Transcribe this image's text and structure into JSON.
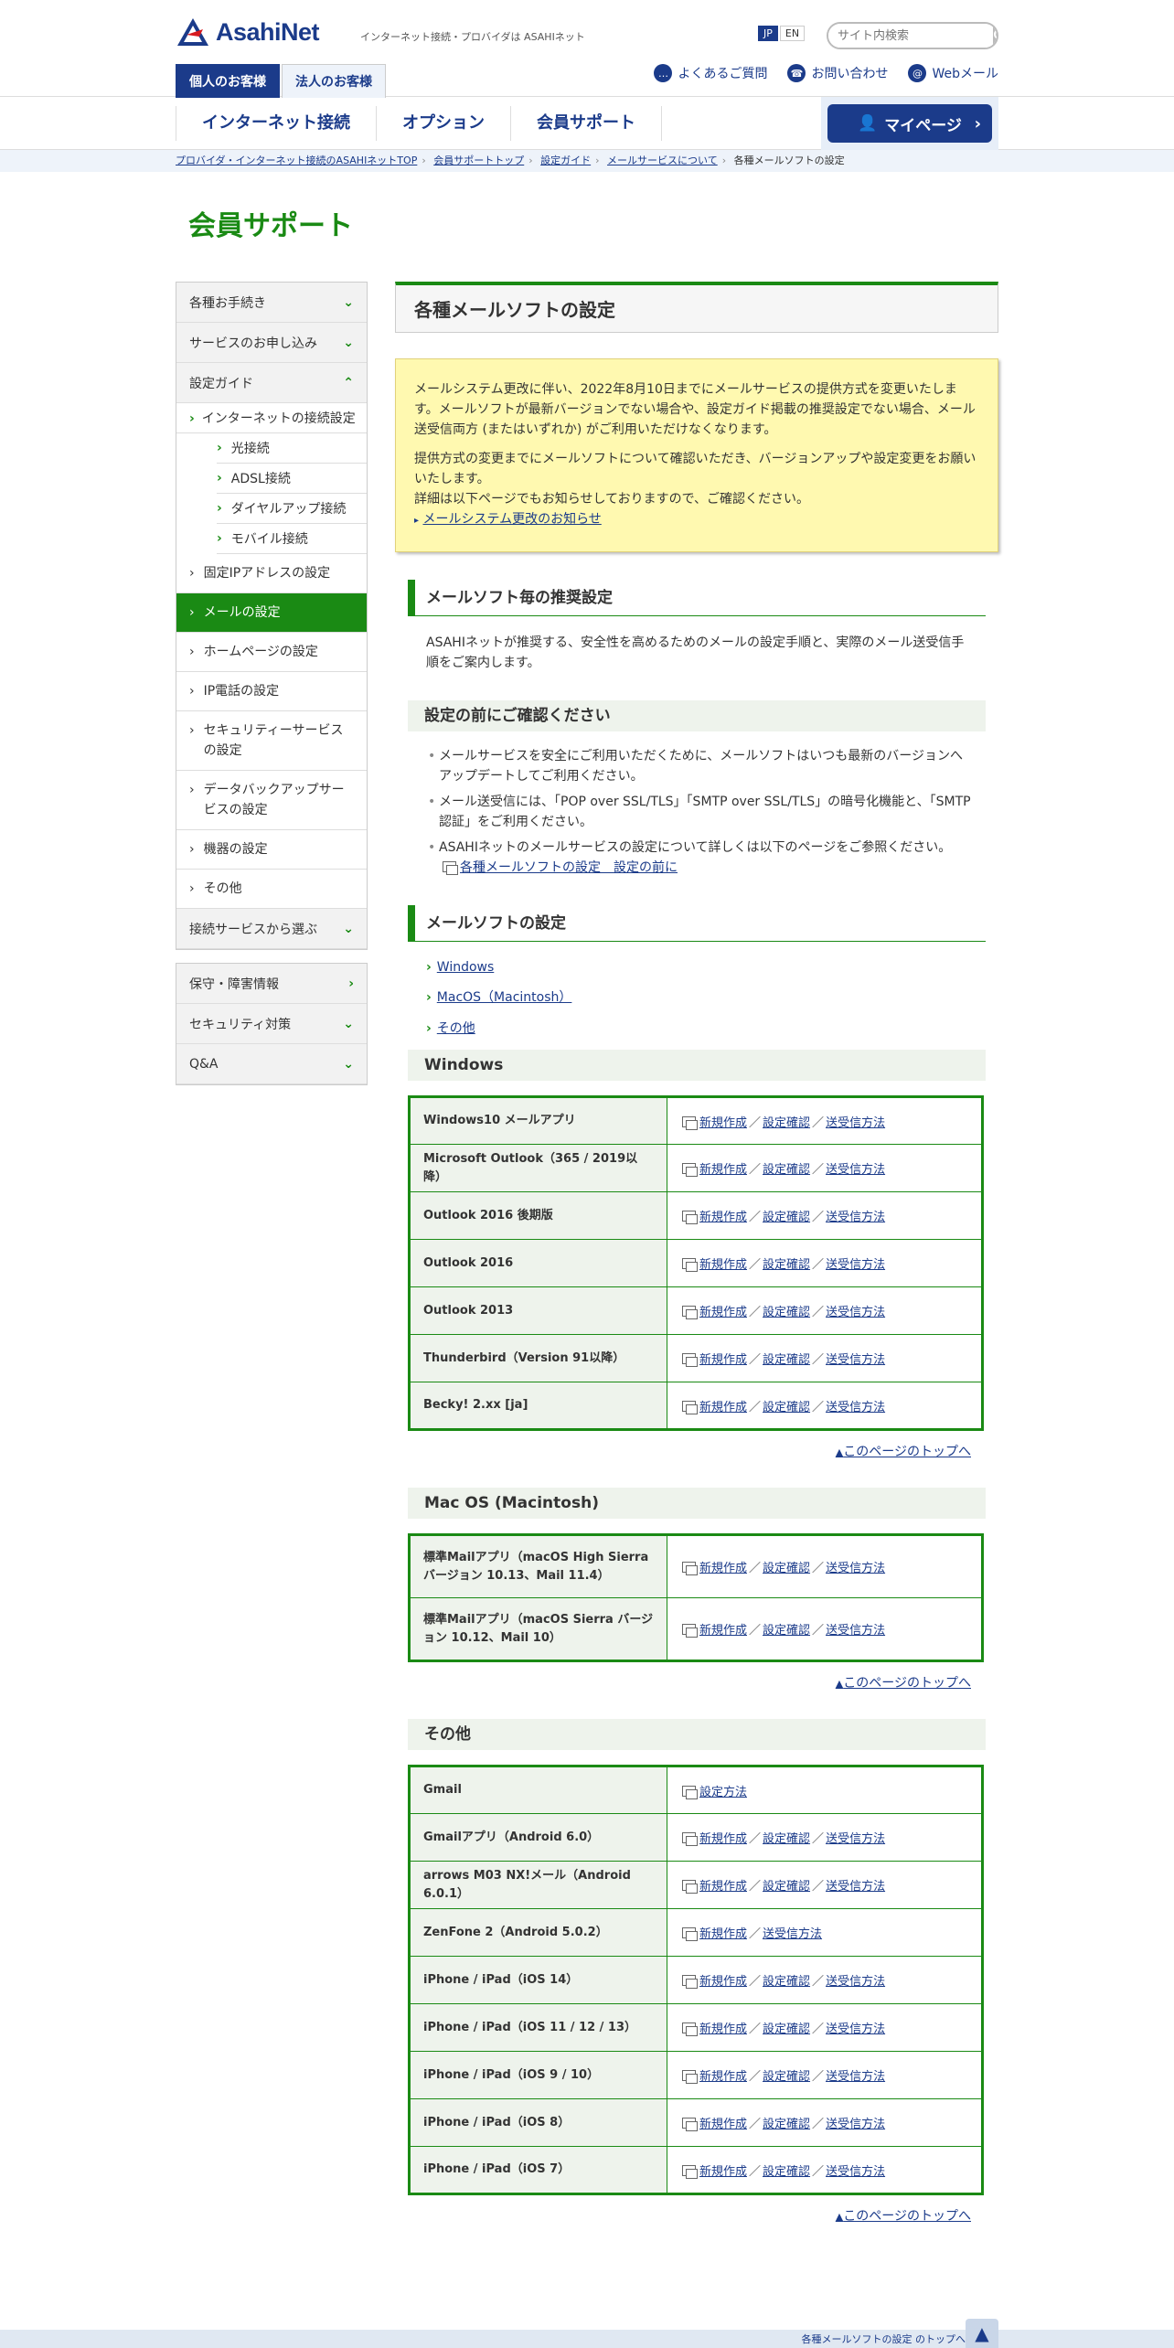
{
  "header": {
    "logo_text": "AsahiNet",
    "tagline": "インターネット接続・プロバイダは ASAHIネット",
    "lang": [
      "JP",
      "EN"
    ],
    "search_placeholder": "サイト内検索",
    "tabs": [
      "個人のお客様",
      "法人のお客様"
    ],
    "links": [
      "よくあるご質問",
      "お問い合わせ",
      "Webメール"
    ]
  },
  "gnav": {
    "items": [
      "インターネット接続",
      "オプション",
      "会員サポート"
    ],
    "mypage": "マイページ"
  },
  "breadcrumb": [
    "プロバイダ・インターネット接続のASAHIネットTOP",
    "会員サポートトップ",
    "設定ガイド",
    "メールサービスについて",
    "各種メールソフトの設定"
  ],
  "page_title": "会員サポート",
  "sidebar": {
    "top": [
      "各種お手続き",
      "サービスのお申し込み",
      "設定ガイド"
    ],
    "guide": "インターネットの接続設定",
    "guide_sub": [
      "光接続",
      "ADSL接続",
      "ダイヤルアップ接続",
      "モバイル接続"
    ],
    "items": [
      "固定IPアドレスの設定",
      "メールの設定",
      "ホームページの設定",
      "IP電話の設定",
      "セキュリティーサービスの設定",
      "データバックアップサービスの設定",
      "機器の設定",
      "その他"
    ],
    "select": "接続サービスから選ぶ",
    "bottom": [
      "保守・障害情報",
      "セキュリティ対策",
      "Q&A"
    ]
  },
  "main": {
    "title": "各種メールソフトの設定",
    "notice_p1": "メールシステム更改に伴い、2022年8月10日までにメールサービスの提供方式を変更いたします。メールソフトが最新バージョンでない場合や、設定ガイド掲載の推奨設定でない場合、メール送受信両方 (またはいずれか) がご利用いただけなくなります。",
    "notice_p2": "提供方式の変更までにメールソフトについて確認いただき、バージョンアップや設定変更をお願いいたします。",
    "notice_p3": "詳細は以下ページでもお知らせしておりますので、ご確認ください。",
    "notice_link": "メールシステム更改のお知らせ",
    "h2_recommend": "メールソフト毎の推奨設定",
    "recommend_text": "ASAHIネットが推奨する、安全性を高めるためのメールの設定手順と、実際のメール送受信手順をご案内します。",
    "h3_before": "設定の前にご確認ください",
    "bullets": [
      "メールサービスを安全にご利用いただくために、メールソフトはいつも最新のバージョンへアップデートしてご利用ください。",
      "メール送受信には、「POP over SSL/TLS」「SMTP over SSL/TLS」の暗号化機能と、「SMTP認証」をご利用ください。",
      "ASAHIネットのメールサービスの設定について詳しくは以下のページをご参照ください。"
    ],
    "before_link": "各種メールソフトの設定　設定の前に",
    "h2_settings": "メールソフトの設定",
    "anchors": [
      "Windows",
      "MacOS（Macintosh）",
      "その他"
    ],
    "link_new": "新規作成",
    "link_check": "設定確認",
    "link_send": "送受信方法",
    "link_setup": "設定方法",
    "to_top": "このページのトップへ",
    "windows_h": "Windows",
    "windows": [
      "Windows10 メールアプリ",
      "Microsoft Outlook（365 / 2019以降）",
      "Outlook 2016 後期版",
      "Outlook 2016",
      "Outlook 2013",
      "Thunderbird（Version 91以降）",
      "Becky! 2.xx [ja]"
    ],
    "mac_h": "Mac OS (Macintosh)",
    "mac": [
      "標準Mailアプリ（macOS High Sierra バージョン 10.13、Mail 11.4）",
      "標準Mailアプリ（macOS Sierra バージョン 10.12、Mail 10）"
    ],
    "other_h": "その他",
    "other": [
      "Gmail",
      "Gmailアプリ（Android 6.0）",
      "arrows M03 NX!メール（Android 6.0.1）",
      "ZenFone 2（Android 5.0.2）",
      "iPhone / iPad（iOS 14）",
      "iPhone / iPad（iOS 11 / 12 / 13）",
      "iPhone / iPad（iOS 9 / 10）",
      "iPhone / iPad（iOS 8）",
      "iPhone / iPad（iOS 7）"
    ]
  },
  "footer": {
    "crumb": "各種メールソフトの設定 のトップへ"
  },
  "colors": {
    "brand_blue": "#1b3b8a",
    "accent_green": "#1a8a14",
    "notice_yellow": "#fff9b0"
  },
  "icons": [
    "logo-mark-icon",
    "search-icon",
    "chat-icon",
    "phone-icon",
    "mail-icon",
    "user-icon",
    "chevron-icon",
    "document-icon",
    "pagetop-icon"
  ]
}
